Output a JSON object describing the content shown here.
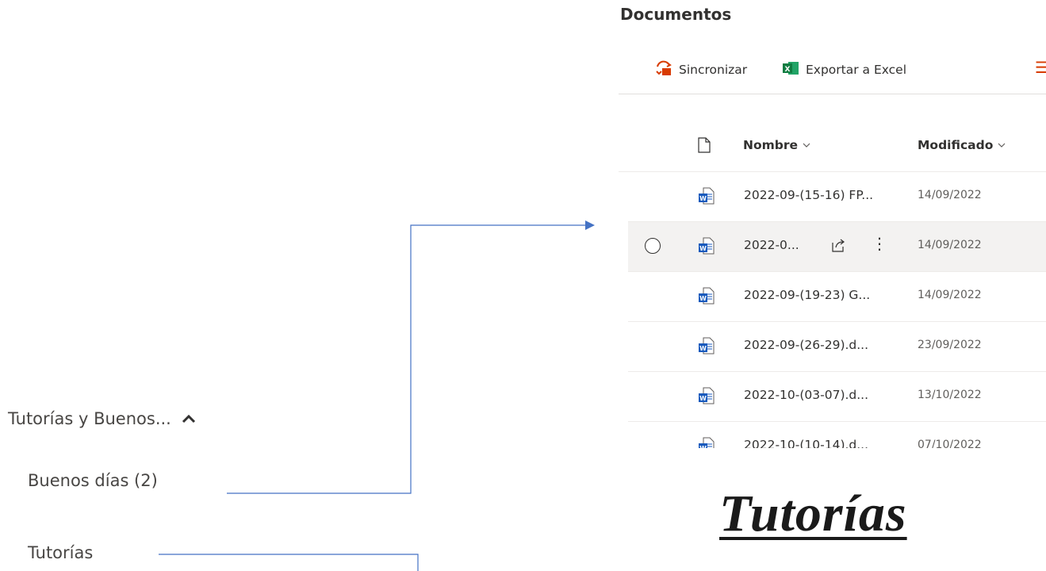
{
  "documents": {
    "title": "Documentos",
    "commands": {
      "sync_label": "Sincronizar",
      "export_label": "Exportar a Excel"
    },
    "columns": {
      "name": "Nombre",
      "modified": "Modificado"
    },
    "rows": [
      {
        "name": "2022-09-(15-16) FP...",
        "date": "14/09/2022"
      },
      {
        "name": "2022-0...",
        "date": "14/09/2022"
      },
      {
        "name": "2022-09-(19-23) G...",
        "date": "14/09/2022"
      },
      {
        "name": "2022-09-(26-29).d...",
        "date": "23/09/2022"
      },
      {
        "name": "2022-10-(03-07).d...",
        "date": "13/10/2022"
      },
      {
        "name": "2022-10-(10-14).d...",
        "date": "07/10/2022"
      }
    ]
  },
  "nav": {
    "section_label": "Tutorías y Buenos...",
    "items": [
      "Buenos días (2)",
      "Tutorías"
    ]
  },
  "heading": "Tutorías",
  "colors": {
    "accent": "#d83b01",
    "word_blue": "#185abd",
    "excel_green": "#107c41",
    "connector": "#4472c4"
  }
}
